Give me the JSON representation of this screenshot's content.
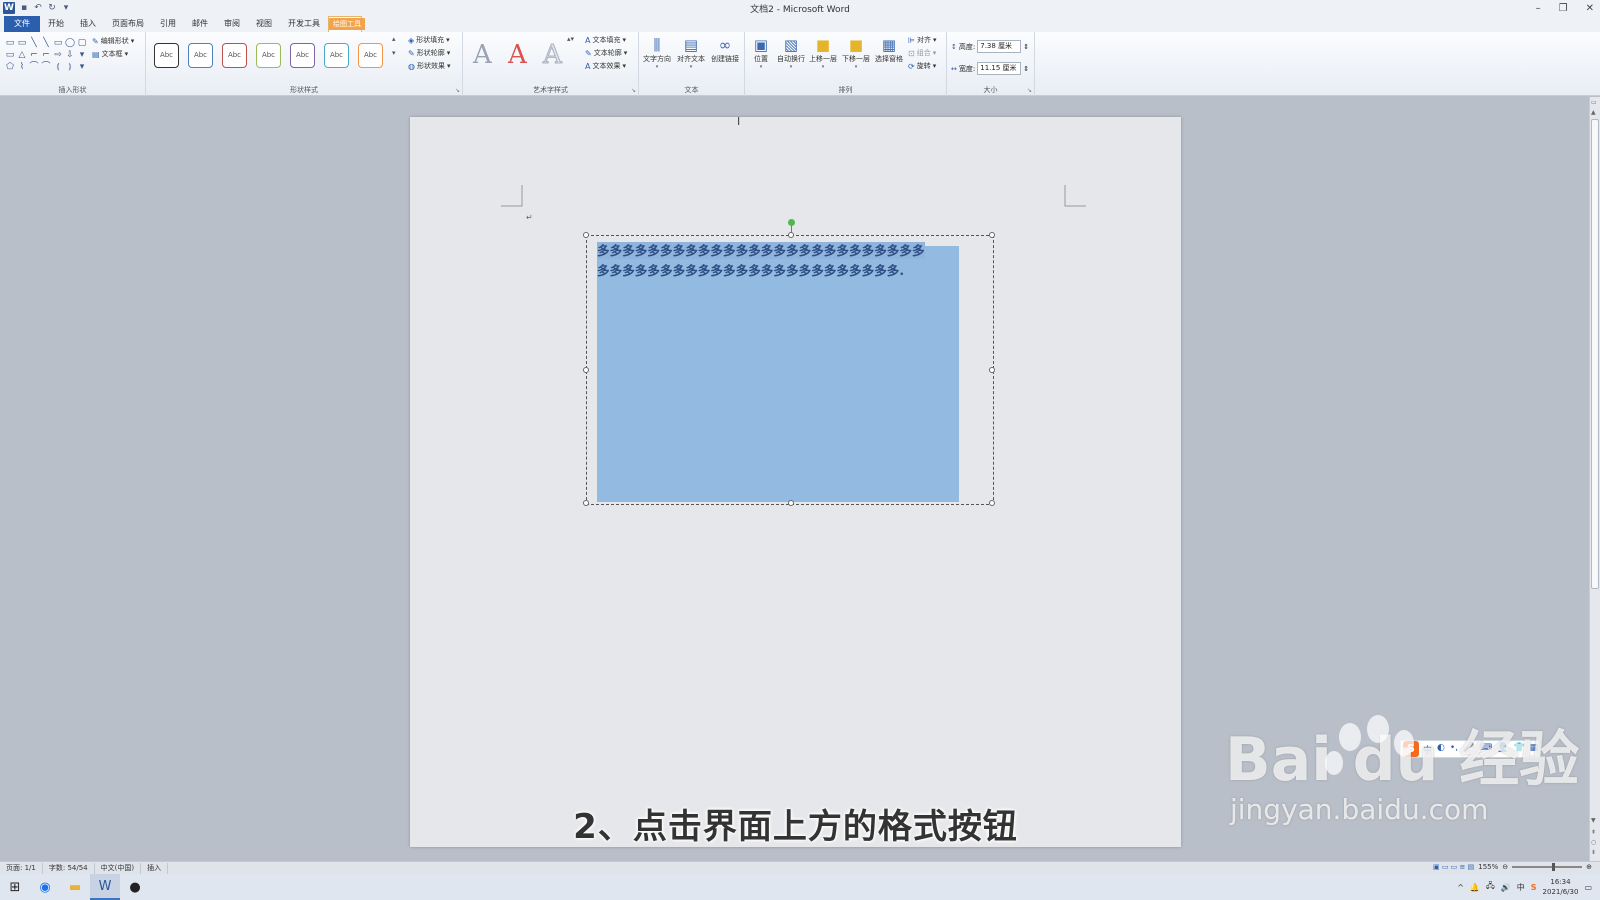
{
  "window": {
    "title": "文档2 - Microsoft Word",
    "controls": [
      "–",
      "❐",
      "✕"
    ]
  },
  "quick_access": [
    "W",
    "💾",
    "↶",
    "↻",
    "▾"
  ],
  "context_tab_header": "绘图工具",
  "tabs": [
    {
      "label": "文件",
      "kind": "file"
    },
    {
      "label": "开始"
    },
    {
      "label": "插入"
    },
    {
      "label": "页面布局"
    },
    {
      "label": "引用"
    },
    {
      "label": "邮件"
    },
    {
      "label": "审阅"
    },
    {
      "label": "视图"
    },
    {
      "label": "开发工具"
    },
    {
      "label": "格式",
      "active": true
    }
  ],
  "ribbon": {
    "insert_shapes": {
      "label": "插入形状",
      "edit_shape": "编辑形状",
      "text_box": "文本框",
      "shapes": [
        "▭",
        "▭",
        "╲",
        "╲",
        "▭",
        "◯",
        "▢",
        "▭",
        "△",
        "⌐",
        "⌐",
        "⇨",
        "⇩",
        "▾",
        "⬠",
        "⌇",
        "⌒",
        "⌒",
        "⦅",
        "⦆",
        "▾"
      ]
    },
    "shape_styles": {
      "label": "形状样式",
      "samples": [
        {
          "text": "Abc",
          "color": "#333333"
        },
        {
          "text": "Abc",
          "color": "#4f81bd"
        },
        {
          "text": "Abc",
          "color": "#c0504d"
        },
        {
          "text": "Abc",
          "color": "#9bbb59"
        },
        {
          "text": "Abc",
          "color": "#8064a2"
        },
        {
          "text": "Abc",
          "color": "#4bacc6"
        },
        {
          "text": "Abc",
          "color": "#f79646"
        }
      ],
      "fill": "形状填充",
      "outline": "形状轮廓",
      "effects": "形状效果"
    },
    "wordart": {
      "label": "艺术字样式",
      "letters": [
        {
          "text": "A",
          "color": "#9aa3b2"
        },
        {
          "text": "A",
          "color": "#d9534f"
        },
        {
          "text": "A",
          "color": "#e0e3e8"
        }
      ],
      "text_fill": "文本填充",
      "text_outline": "文本轮廓",
      "text_effects": "文本效果"
    },
    "text": {
      "label": "文本",
      "direction": "文字方向",
      "align": "对齐文本",
      "link": "创建链接"
    },
    "arrange": {
      "label": "排列",
      "position": "位置",
      "wrap": "自动换行",
      "bring_forward": "上移一层",
      "send_backward": "下移一层",
      "selection_pane": "选择窗格",
      "align": "对齐",
      "group": "组合",
      "rotate": "旋转"
    },
    "size": {
      "label": "大小",
      "height_label": "高度:",
      "height_value": "7.38 厘米",
      "width_label": "宽度:",
      "width_value": "11.15 厘米"
    }
  },
  "document": {
    "paragraph_mark": "↵",
    "textbox_line1": "多多多多多多多多多多多多多多多多多多多多多多多多多多",
    "textbox_line2": "多多多多多多多多多多多多多多多多多多多多多多多多.",
    "caption": "2、点击界面上方的格式按钮"
  },
  "status": {
    "page": "页面: 1/1",
    "words": "字数: 54/54",
    "language": "中文(中国)",
    "mode": "插入",
    "zoom": "155%"
  },
  "taskbar": {
    "apps": [
      {
        "icon": "⊞",
        "color": "#222222"
      },
      {
        "icon": "◉",
        "color": "#1a73e8"
      },
      {
        "icon": "▬",
        "color": "#e8b23a"
      },
      {
        "icon": "W",
        "color": "#2b5797",
        "active": true
      },
      {
        "icon": "●",
        "color": "#222222"
      }
    ],
    "tray": [
      "^",
      "🔔",
      "🖧",
      "🔊",
      "中",
      "S"
    ],
    "time": "16:34",
    "date": "2021/6/30"
  },
  "ime_toolbar": {
    "logo": "S",
    "items": [
      "中",
      "◐",
      "•,",
      "🎤",
      "⌨",
      "👤",
      "👕",
      "▦"
    ]
  },
  "watermark": {
    "main": "Bai du 经验",
    "sub": "jingyan.baidu.com"
  }
}
